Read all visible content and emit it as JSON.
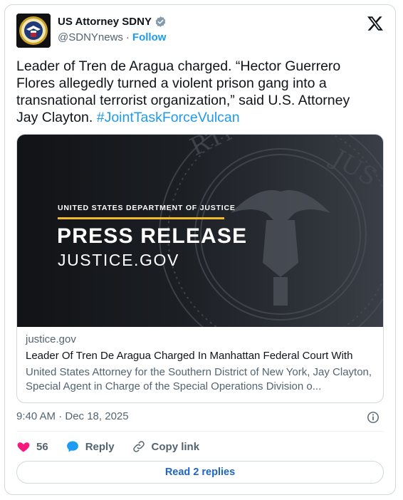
{
  "author": {
    "display_name": "US Attorney SDNY",
    "handle": "@SDNYnews",
    "separator": "·",
    "follow_label": "Follow",
    "avatar_icon": "doj-seal-icon",
    "verified_icon": "verified-badge-icon"
  },
  "platform_icon": "x-logo-icon",
  "tweet": {
    "text": "Leader of Tren de Aragua charged. “Hector Guerrero Flores allegedly turned a violent prison gang into a transnational terrorist organization,” said U.S. Attorney Jay Clayton.",
    "hashtag": "#JointTaskForceVulcan"
  },
  "link_card": {
    "image": {
      "dept_label": "UNITED STATES DEPARTMENT OF JUSTICE",
      "title": "PRESS RELEASE",
      "subtitle": "JUSTICE.GOV",
      "accent_color": "#f2b92b"
    },
    "domain": "justice.gov",
    "title": "Leader Of Tren De Aragua Charged In Manhattan Federal Court With",
    "description": "United States Attorney for the Southern District of New York, Jay Clayton, Special Agent in Charge of the Special Operations Division o..."
  },
  "timestamp": "9:40 AM · Dec 18, 2025",
  "actions": {
    "like_count": "56",
    "reply_label": "Reply",
    "copy_link_label": "Copy link"
  },
  "read_replies_label": "Read 2 replies",
  "colors": {
    "link_blue": "#1d9bf0",
    "heart_red": "#f91880",
    "text_secondary": "#536471"
  }
}
